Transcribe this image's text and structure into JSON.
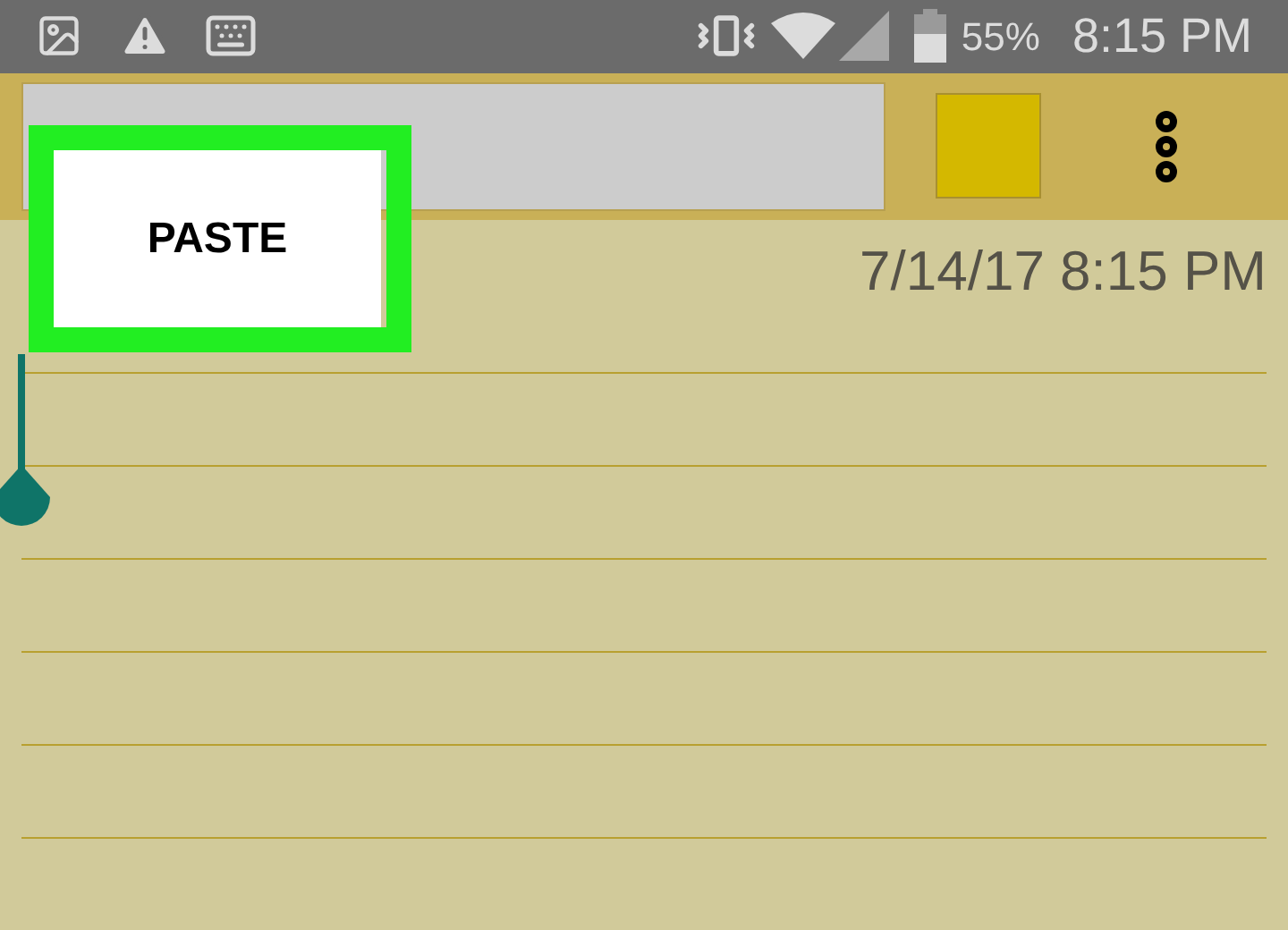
{
  "status_bar": {
    "battery": "55%",
    "time": "8:15 PM"
  },
  "toolbar": {
    "color_swatch": {
      "color": "#d4b800"
    }
  },
  "context_menu": {
    "label": "PASTE"
  },
  "note": {
    "timestamp": "7/14/17 8:15 PM"
  }
}
